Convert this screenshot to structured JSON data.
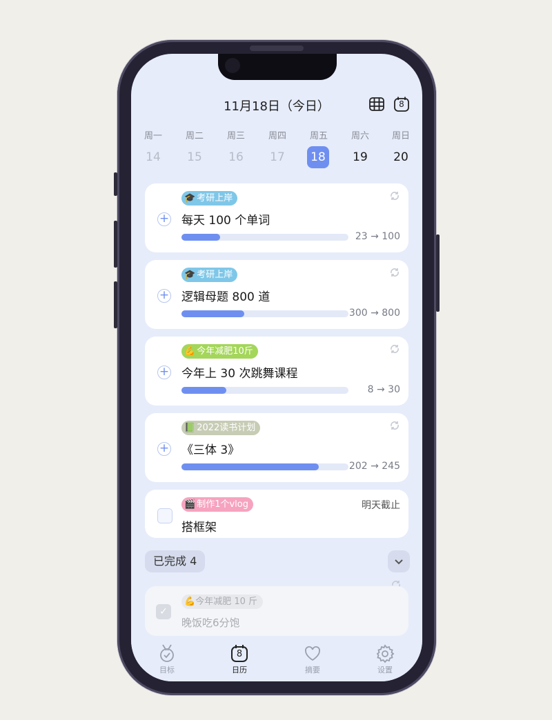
{
  "header": {
    "title": "11月18日（今日）",
    "calendar_badge": "8"
  },
  "weekdays": [
    "周一",
    "周二",
    "周三",
    "周四",
    "周五",
    "周六",
    "周日"
  ],
  "dates": [
    {
      "day": "14",
      "state": "past"
    },
    {
      "day": "15",
      "state": "past"
    },
    {
      "day": "16",
      "state": "past"
    },
    {
      "day": "17",
      "state": "past"
    },
    {
      "day": "18",
      "state": "today"
    },
    {
      "day": "19",
      "state": "future"
    },
    {
      "day": "20",
      "state": "future"
    }
  ],
  "tasks": [
    {
      "tag_emoji": "🎓",
      "tag": "考研上岸",
      "tag_color": "#7fc7e8",
      "title": "每天 100 个单词",
      "progress_text": "23 → 100",
      "progress": 0.23
    },
    {
      "tag_emoji": "🎓",
      "tag": "考研上岸",
      "tag_color": "#7fc7e8",
      "title": "逻辑母题 800 道",
      "progress_text": "300 → 800",
      "progress": 0.375
    },
    {
      "tag_emoji": "💪",
      "tag": "今年减肥10斤",
      "tag_color": "#a4d65a",
      "title": "今年上 30 次跳舞课程",
      "progress_text": "8 → 30",
      "progress": 0.267
    },
    {
      "tag_emoji": "📗",
      "tag": "2022读书计划",
      "tag_color": "#c7ccb5",
      "title": "《三体 3》",
      "progress_text": "202 → 245",
      "progress": 0.824
    }
  ],
  "todo": {
    "tag_emoji": "🎬",
    "tag": "制作1个vlog",
    "tag_color": "#f6a3c0",
    "title": "搭框架",
    "due": "明天截止"
  },
  "completed": {
    "label": "已完成 4",
    "item": {
      "tag_emoji": "💪",
      "tag": "今年减肥 10 斤",
      "title": "晚饭吃6分饱"
    }
  },
  "tabs": [
    {
      "label": "目标",
      "icon": "medal-icon",
      "active": false
    },
    {
      "label": "日历",
      "icon": "calendar-icon",
      "active": true,
      "badge": "8"
    },
    {
      "label": "摘要",
      "icon": "heart-icon",
      "active": false
    },
    {
      "label": "设置",
      "icon": "gear-icon",
      "active": false
    }
  ],
  "colors": {
    "accent": "#6f8ff0",
    "screen_bg": "#e6ecfa"
  }
}
